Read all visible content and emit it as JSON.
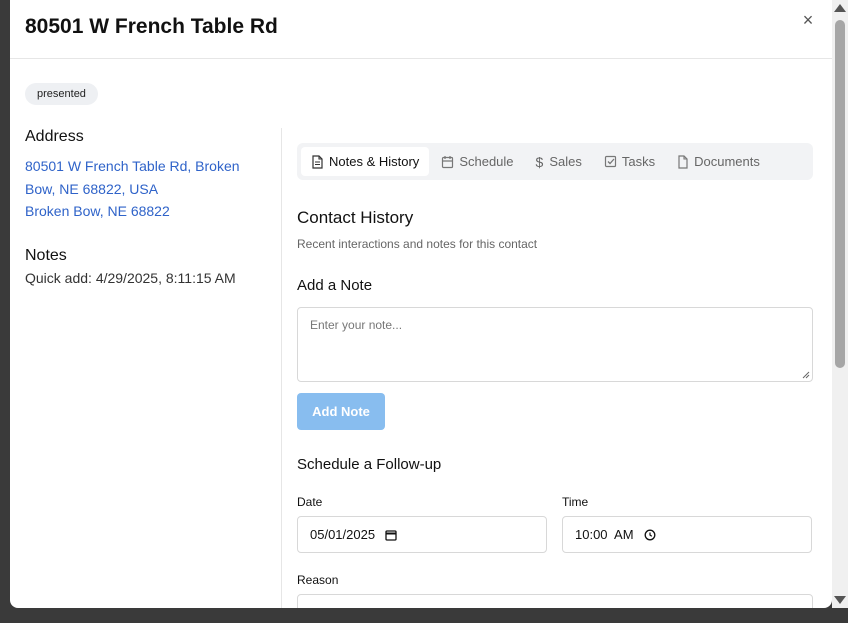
{
  "modal": {
    "title": "80501 W French Table Rd",
    "close_glyph": "×",
    "status_badge": "presented"
  },
  "contact": {
    "address_heading": "Address",
    "address_line1": "80501 W French Table Rd, Broken",
    "address_line2": "Bow, NE 68822, USA",
    "address_line3": "Broken Bow, NE 68822",
    "notes_heading": "Notes",
    "notes_value": "Quick add: 4/29/2025, 8:11:15 AM"
  },
  "tabs": [
    {
      "label": "Notes & History",
      "icon": "document-icon",
      "active": true
    },
    {
      "label": "Schedule",
      "icon": "calendar-icon",
      "active": false
    },
    {
      "label": "Sales",
      "icon": "dollar-icon",
      "active": false
    },
    {
      "label": "Tasks",
      "icon": "checkbox-icon",
      "active": false
    },
    {
      "label": "Documents",
      "icon": "file-icon",
      "active": false
    }
  ],
  "history": {
    "title": "Contact History",
    "subtitle": "Recent interactions and notes for this contact",
    "add_note_heading": "Add a Note",
    "note_placeholder": "Enter your note...",
    "add_note_button": "Add Note"
  },
  "followup": {
    "heading": "Schedule a Follow-up",
    "date_label": "Date",
    "date_value": "05/01/2025",
    "time_label": "Time",
    "time_value": "10:00  AM",
    "reason_label": "Reason"
  },
  "colors": {
    "link": "#2f63c9",
    "button_disabled": "#88bdef",
    "tab_bar_bg": "#f2f3f5"
  }
}
